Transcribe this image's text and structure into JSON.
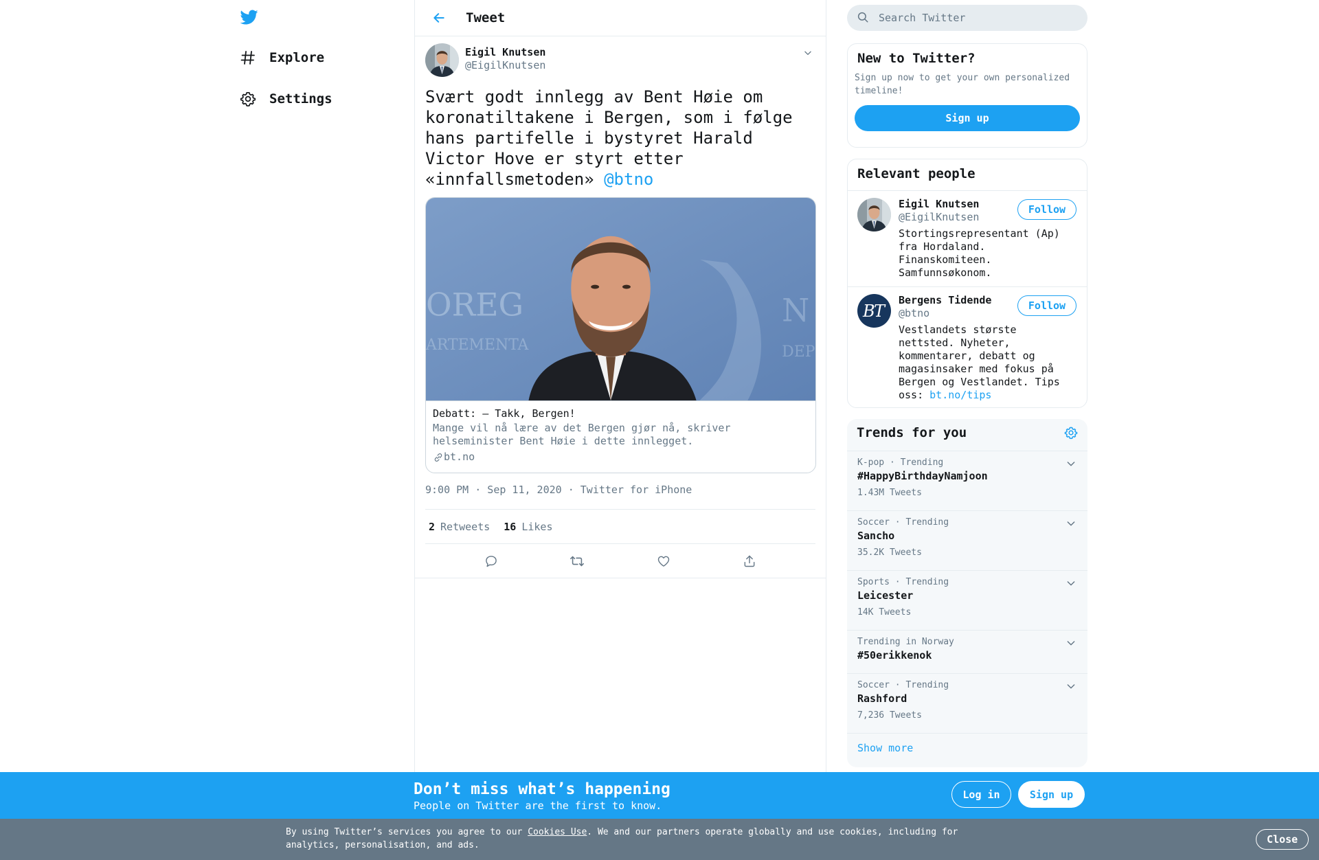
{
  "nav": {
    "logo": "twitter-bird-icon",
    "items": [
      {
        "label": "Explore",
        "icon": "hashtag-icon"
      },
      {
        "label": "Settings",
        "icon": "gear-icon"
      }
    ]
  },
  "header": {
    "title": "Tweet"
  },
  "tweet": {
    "author_name": "Eigil Knutsen",
    "author_handle": "@EigilKnutsen",
    "text": "Svært godt innlegg av Bent Høie om koronatiltakene i Bergen, som i følge hans partifelle i bystyret Harald Victor Hove er styrt etter «innfallsmetoden» ",
    "mention": "@btno",
    "card": {
      "title": "Debatt: – Takk, Bergen!",
      "description": "Mange vil nå lære av det Bergen gjør nå, skriver helseminister Bent Høie i dette innlegget.",
      "domain": "bt.no"
    },
    "meta": "9:00 PM · Sep 11, 2020 · Twitter for iPhone",
    "retweets_count": "2",
    "retweets_label": "Retweets",
    "likes_count": "16",
    "likes_label": "Likes"
  },
  "search": {
    "placeholder": "Search Twitter"
  },
  "new_to_twitter": {
    "title": "New to Twitter?",
    "subtitle": "Sign up now to get your own personalized timeline!",
    "button": "Sign up"
  },
  "relevant": {
    "title": "Relevant people",
    "people": [
      {
        "name": "Eigil Knutsen",
        "handle": "@EigilKnutsen",
        "bio": "Stortingsrepresentant (Ap) fra Hordaland. Finanskomiteen. Samfunnsøkonom.",
        "bio_link": "",
        "follow": "Follow"
      },
      {
        "name": "Bergens Tidende",
        "handle": "@btno",
        "bio": "Vestlandets største nettsted. Nyheter, kommentarer, debatt og magasinsaker med fokus på Bergen og Vestlandet. Tips oss: ",
        "bio_link": "bt.no/tips",
        "follow": "Follow"
      }
    ]
  },
  "trends": {
    "title": "Trends for you",
    "items": [
      {
        "context": "K-pop · Trending",
        "name": "#HappyBirthdayNamjoon",
        "count": "1.43M Tweets"
      },
      {
        "context": "Soccer · Trending",
        "name": "Sancho",
        "count": "35.2K Tweets"
      },
      {
        "context": "Sports · Trending",
        "name": "Leicester",
        "count": "14K Tweets"
      },
      {
        "context": "Trending in Norway",
        "name": "#50erikkenok",
        "count": ""
      },
      {
        "context": "Soccer · Trending",
        "name": "Rashford",
        "count": "7,236 Tweets"
      }
    ],
    "show_more": "Show more"
  },
  "bottom_bar": {
    "title": "Don’t miss what’s happening",
    "subtitle": "People on Twitter are the first to know.",
    "login": "Log in",
    "signup": "Sign up"
  },
  "cookie": {
    "before": "By using Twitter’s services you agree to our ",
    "link": "Cookies Use",
    "after": ". We and our partners operate globally and use cookies, including for analytics, personalisation, and ads.",
    "close": "Close"
  },
  "colors": {
    "accent": "#1da1f2",
    "muted": "#657786",
    "border": "#e6ecf0",
    "cookie_bg": "#657786"
  }
}
